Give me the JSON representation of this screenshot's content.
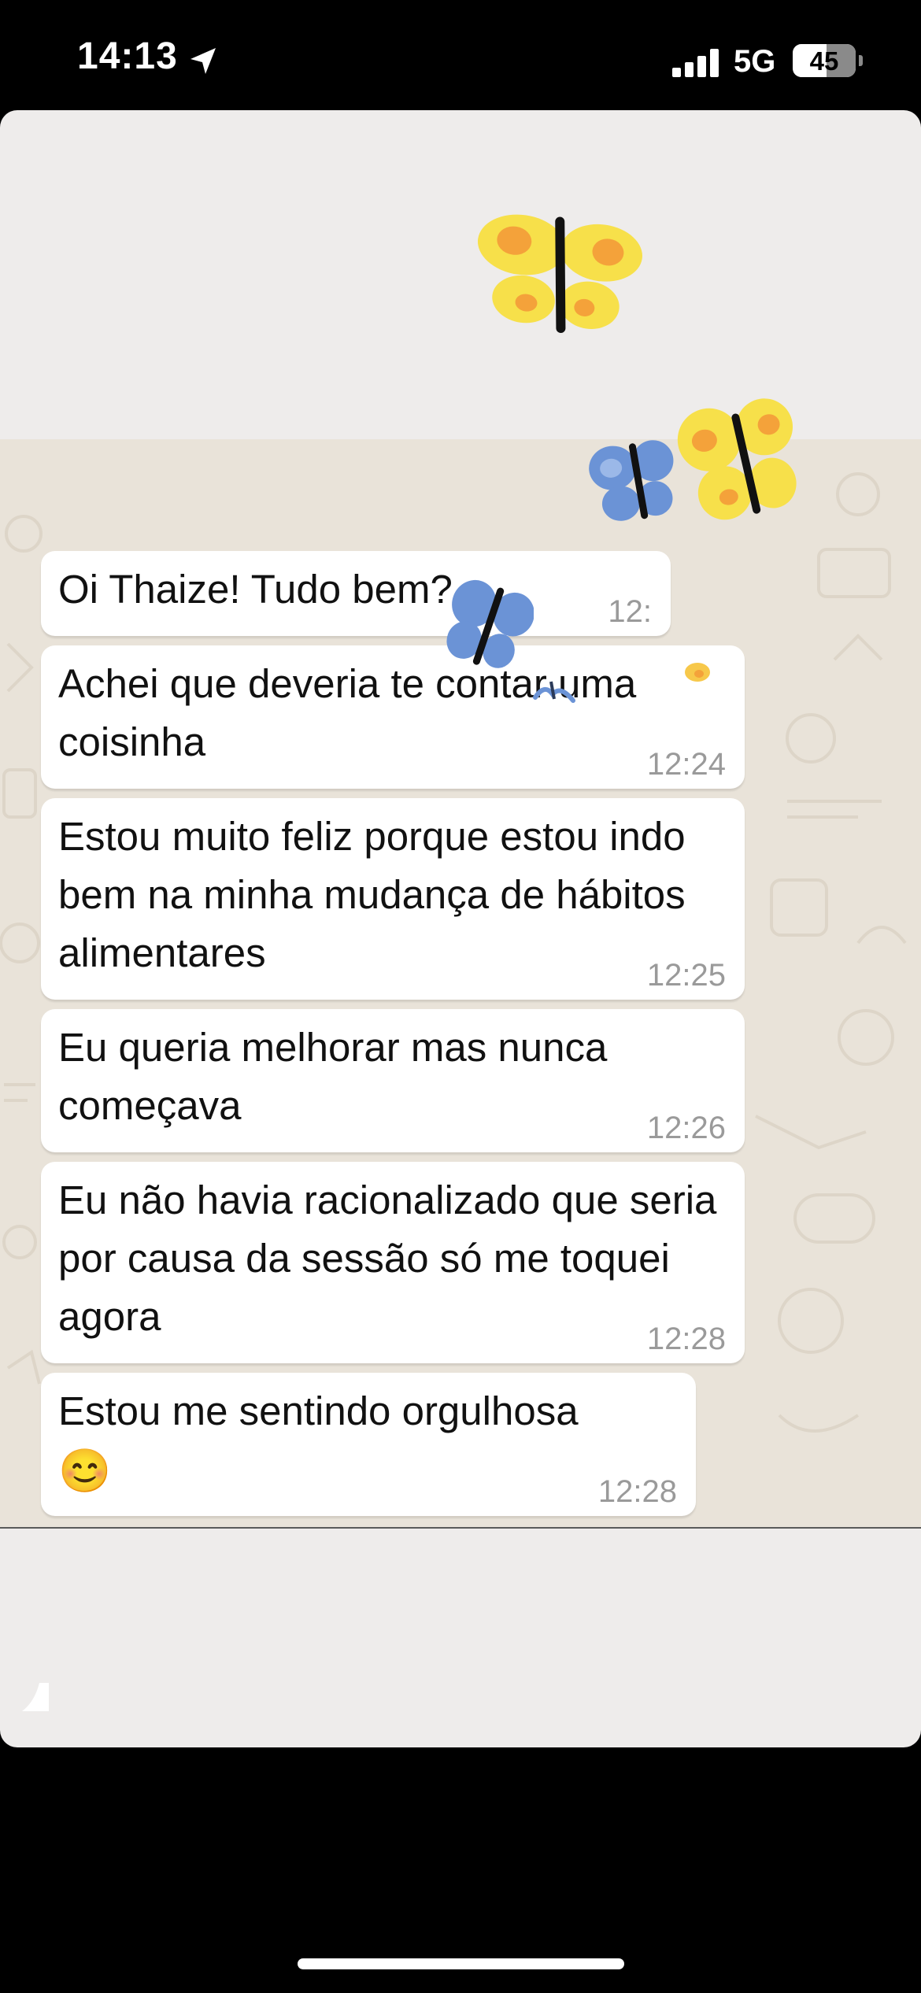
{
  "status_bar": {
    "time": "14:13",
    "network": "5G",
    "battery": "45",
    "battery_level_percent": 45,
    "location_icon": "location-arrow-icon",
    "signal_icon": "signal-bars-icon"
  },
  "chat": {
    "messages": [
      {
        "text": "Oi Thaize! Tudo bem?",
        "time": "12:"
      },
      {
        "text": "Achei que deveria te contar uma coisinha",
        "time": "12:24"
      },
      {
        "text": "Estou muito feliz porque estou indo bem na minha mudança de hábitos alimentares",
        "time": "12:25"
      },
      {
        "text": "Eu queria melhorar mas nunca começava",
        "time": "12:26"
      },
      {
        "text": "Eu não havia racionalizado que seria por causa da sessão só me toquei agora",
        "time": "12:28"
      },
      {
        "text": "Estou me sentindo orgulhosa",
        "time": "12:28",
        "emoji": "😊"
      }
    ]
  },
  "stickers": [
    "butterfly-yellow-icon",
    "butterfly-blue-icon"
  ],
  "colors": {
    "story_background": "#eeeceb",
    "chat_wallpaper": "#e9e3d9",
    "bubble": "#ffffff",
    "butterfly_yellow": "#f7e04a",
    "butterfly_orange": "#f4a23a",
    "butterfly_blue": "#6b93d6"
  }
}
